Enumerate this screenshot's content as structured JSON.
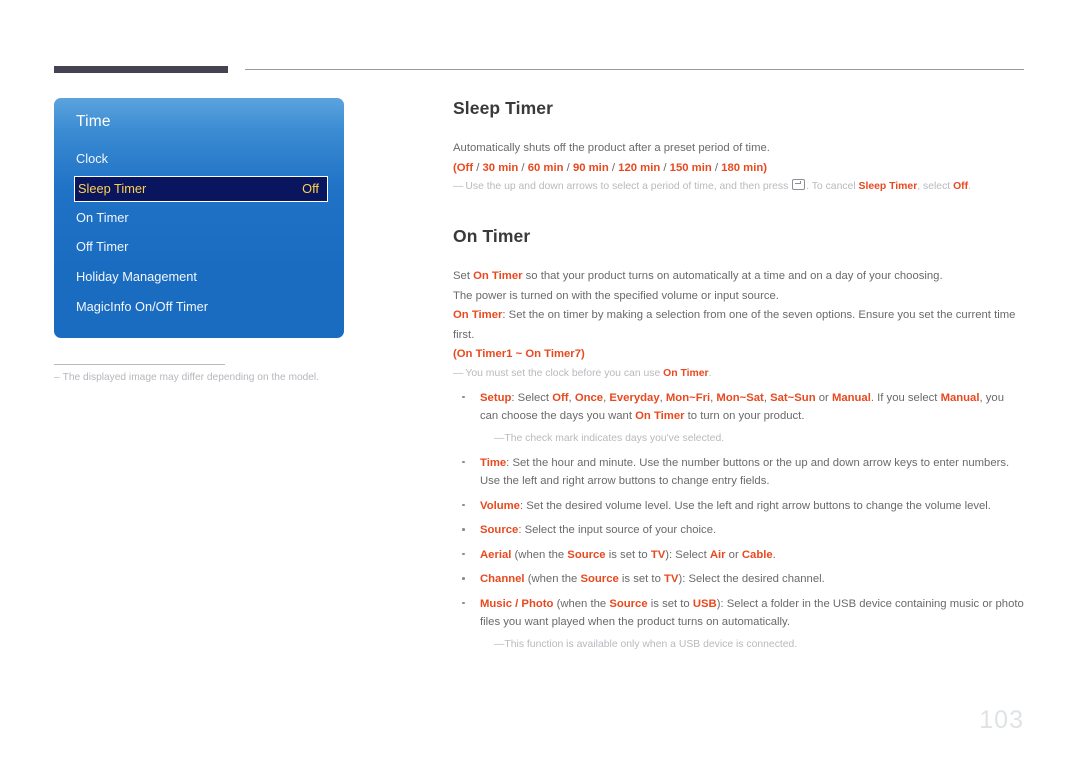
{
  "page": {
    "number": "103"
  },
  "osd": {
    "title": "Time",
    "items": [
      {
        "label": "Clock",
        "value": "",
        "selected": false
      },
      {
        "label": "Sleep Timer",
        "value": "Off",
        "selected": true
      },
      {
        "label": "On Timer",
        "value": "",
        "selected": false
      },
      {
        "label": "Off Timer",
        "value": "",
        "selected": false
      },
      {
        "label": "Holiday Management",
        "value": "",
        "selected": false
      },
      {
        "label": "MagicInfo On/Off Timer",
        "value": "",
        "selected": false
      }
    ],
    "caption_dash": "–",
    "caption": "The displayed image may differ depending on the model."
  },
  "sleep_timer": {
    "heading": "Sleep Timer",
    "description": "Automatically shuts off the product after a preset period of time.",
    "options_line": {
      "open_paren": "(",
      "options": [
        "Off",
        "30 min",
        "60 min",
        "90 min",
        "120 min",
        "150 min",
        "180 min"
      ],
      "separator": " / ",
      "close_paren": ")"
    },
    "note": {
      "dash": "—",
      "text_1": "Use the up and down arrows to select a period of time, and then press ",
      "key_icon": "enter-key-icon",
      "text_2": ". To cancel ",
      "hl_1": "Sleep Timer",
      "text_3": ", select ",
      "hl_2": "Off",
      "text_4": "."
    }
  },
  "on_timer": {
    "heading": "On Timer",
    "para_1": {
      "text_1": "Set ",
      "hl_1": "On Timer",
      "text_2": " so that your product turns on automatically at a time and on a day of your choosing."
    },
    "para_2": "The power is turned on with the specified volume or input source.",
    "para_3": {
      "hl_1": "On Timer",
      "text_1": ": Set the on timer by making a selection from one of the seven options. Ensure you set the current time first."
    },
    "range_line": {
      "open_paren": "(",
      "from": "On Timer1",
      "tilde": " ~ ",
      "to": "On Timer7",
      "close_paren": ")"
    },
    "note_clock": {
      "dash": "—",
      "text_1": "You must set the clock before you can use ",
      "hl_1": "On Timer",
      "text_2": "."
    },
    "bullets": [
      {
        "name": "setup",
        "label": "Setup",
        "text_1": ": Select ",
        "options": [
          "Off",
          "Once",
          "Everyday",
          "Mon~Fri",
          "Mon~Sat",
          "Sat~Sun"
        ],
        "text_2": " or ",
        "hl_manual_1": "Manual",
        "text_3": ". If you select ",
        "hl_manual_2": "Manual",
        "text_4": ", you can choose the days you want ",
        "hl_on_timer": "On Timer",
        "text_5": " to turn on your product.",
        "sub_note": {
          "dash": "—",
          "text": "The check mark indicates days you've selected."
        }
      },
      {
        "name": "time",
        "label": "Time",
        "text_1": ": Set the hour and minute. Use the number buttons or the up and down arrow keys to enter numbers. Use the left and right arrow buttons to change entry fields."
      },
      {
        "name": "volume",
        "label": "Volume",
        "text_1": ": Set the desired volume level. Use the left and right arrow buttons to change the volume level."
      },
      {
        "name": "source",
        "label": "Source",
        "text_1": ": Select the input source of your choice."
      },
      {
        "name": "aerial",
        "label": "Aerial",
        "text_1": " (when the ",
        "hl_source": "Source",
        "text_2": " is set to ",
        "hl_tv": "TV",
        "text_3": "): Select ",
        "hl_air": "Air",
        "text_4": " or ",
        "hl_cable": "Cable",
        "text_5": "."
      },
      {
        "name": "channel",
        "label": "Channel",
        "text_1": " (when the ",
        "hl_source": "Source",
        "text_2": " is set to ",
        "hl_tv": "TV",
        "text_3": "): Select the desired channel."
      },
      {
        "name": "music-photo",
        "label": "Music / Photo",
        "text_1": " (when the ",
        "hl_source": "Source",
        "text_2": " is set to ",
        "hl_usb": "USB",
        "text_3": "): Select a folder in the USB device containing music or photo files you want played when the product turns on automatically.",
        "sub_note": {
          "dash": "—",
          "text": "This function is available only when a USB device is connected."
        }
      }
    ]
  }
}
